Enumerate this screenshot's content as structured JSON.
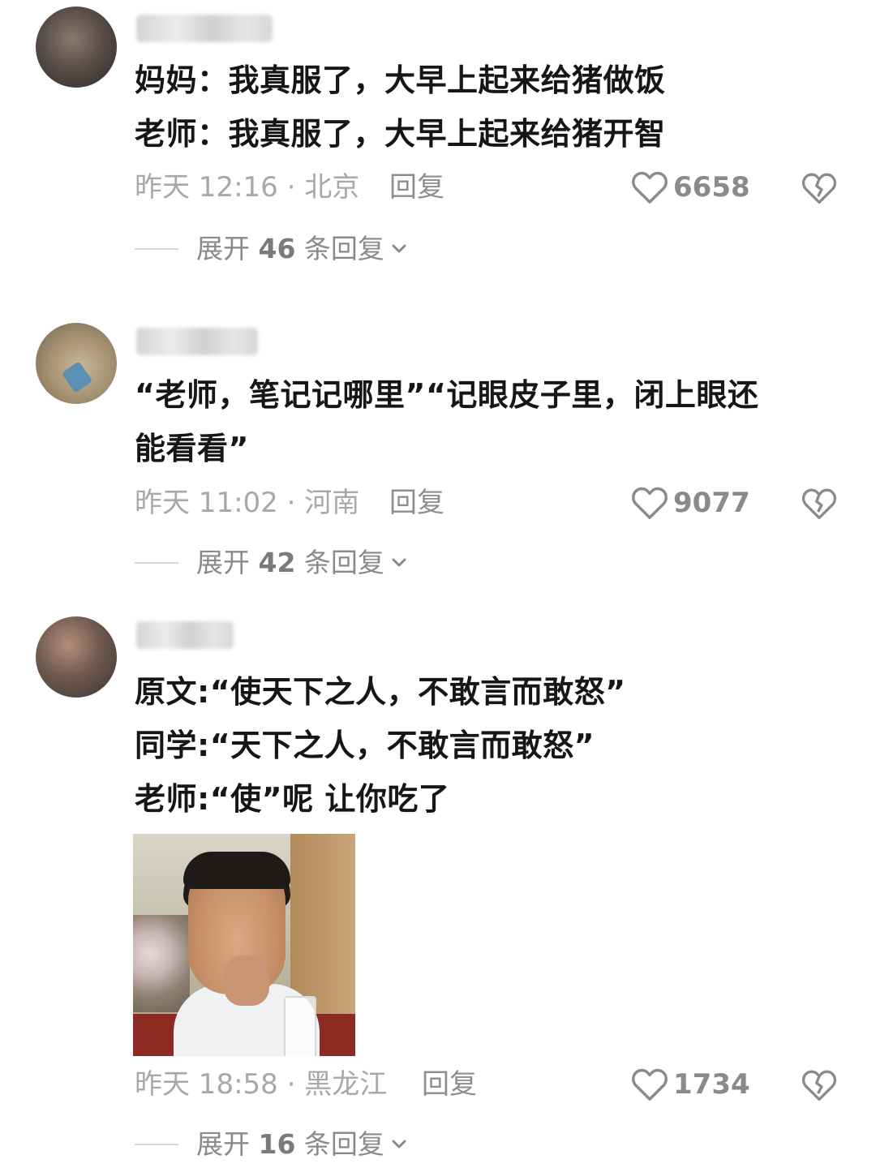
{
  "comments": [
    {
      "content_lines": [
        "妈妈：我真服了，大早上起来给猪做饭",
        "老师：我真服了，大早上起来给猪开智"
      ],
      "time_location": "昨天 12:16 · 北京",
      "reply_label": "回复",
      "likes": "6658",
      "expand_prefix": "展开 ",
      "expand_count": "46",
      "expand_suffix": " 条回复"
    },
    {
      "content_lines": [
        "“老师，笔记记哪里”“记眼皮子里，闭上眼还",
        "能看看”"
      ],
      "time_location": "昨天 11:02 · 河南",
      "reply_label": "回复",
      "likes": "9077",
      "expand_prefix": "展开 ",
      "expand_count": "42",
      "expand_suffix": " 条回复"
    },
    {
      "content_lines": [
        "原文:“使天下之人，不敢言而敢怒”",
        "同学:“天下之人，不敢言而敢怒”",
        "老师:“使”呢 让你吃了"
      ],
      "time_location": "昨天 18:58 · 黑龙江",
      "reply_label": "回复",
      "likes": "1734",
      "expand_prefix": "展开 ",
      "expand_count": "16",
      "expand_suffix": " 条回复"
    }
  ],
  "icons": {
    "like": "heart-outline-icon",
    "dislike": "broken-heart-icon",
    "expand": "chevron-down-icon"
  },
  "colors": {
    "text": "#161616",
    "meta": "#a8a8a8",
    "secondary": "#8a8a8a"
  }
}
